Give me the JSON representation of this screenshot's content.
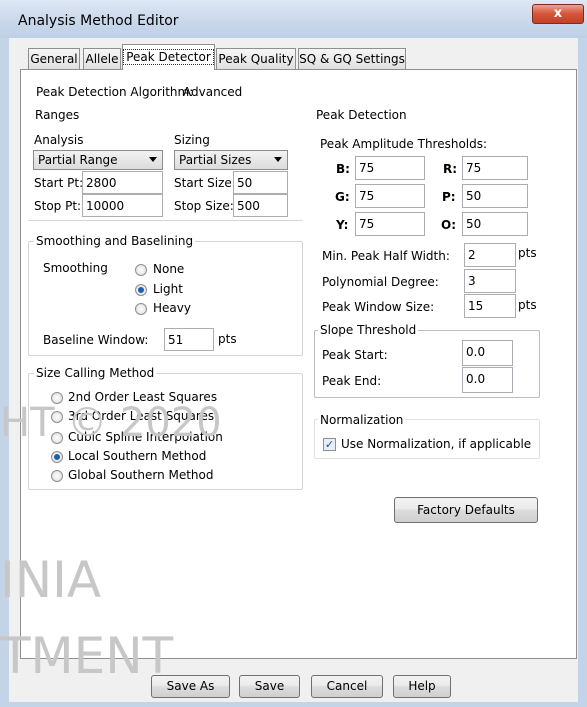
{
  "window": {
    "title": "Analysis Method Editor",
    "close_glyph": "x"
  },
  "tabs": [
    "General",
    "Allele",
    "Peak Detector",
    "Peak Quality",
    "SQ & GQ Settings"
  ],
  "algorithm": {
    "label": "Peak Detection Algorithm:",
    "value": "Advanced"
  },
  "ranges": {
    "title": "Ranges",
    "analysis_label": "Analysis",
    "sizing_label": "Sizing",
    "analysis_select": "Partial Range",
    "sizing_select": "Partial Sizes",
    "start_pt_label": "Start Pt:",
    "start_pt": "2800",
    "stop_pt_label": "Stop Pt:",
    "stop_pt": "10000",
    "start_size_label": "Start Size:",
    "start_size": "50",
    "stop_size_label": "Stop Size:",
    "stop_size": "500"
  },
  "smoothing": {
    "title": "Smoothing and Baselining",
    "label": "Smoothing",
    "options": [
      "None",
      "Light",
      "Heavy"
    ],
    "selected": "Light",
    "baseline_label": "Baseline Window:",
    "baseline_value": "51",
    "baseline_unit": "pts"
  },
  "size_calling": {
    "title": "Size Calling Method",
    "options": [
      "2nd Order Least Squares",
      "3rd Order Least Squares",
      "Cubic Spline Interpolation",
      "Local Southern Method",
      "Global Southern Method"
    ],
    "selected": "Local Southern Method"
  },
  "peak_detection": {
    "title": "Peak Detection",
    "thresholds_label": "Peak Amplitude Thresholds:",
    "B_label": "B:",
    "B": "75",
    "R_label": "R:",
    "R": "75",
    "G_label": "G:",
    "G": "75",
    "P_label": "P:",
    "P": "50",
    "Y_label": "Y:",
    "Y": "75",
    "O_label": "O:",
    "O": "50",
    "min_half_width_label": "Min. Peak Half Width:",
    "min_half_width": "2",
    "poly_degree_label": "Polynomial Degree:",
    "poly_degree": "3",
    "window_size_label": "Peak Window Size:",
    "window_size": "15",
    "unit": "pts"
  },
  "slope": {
    "title": "Slope Threshold",
    "start_label": "Peak Start:",
    "start": "0.0",
    "end_label": "Peak End:",
    "end": "0.0"
  },
  "normalization": {
    "title": "Normalization",
    "checkbox_label": "Use Normalization, if applicable",
    "checked": true
  },
  "buttons": {
    "factory_defaults": "Factory Defaults",
    "save_as": "Save As",
    "save": "Save",
    "cancel": "Cancel",
    "help": "Help"
  },
  "watermark": {
    "line1": "HT © 2020",
    "line2": "INIA",
    "line3": "TMENT"
  }
}
